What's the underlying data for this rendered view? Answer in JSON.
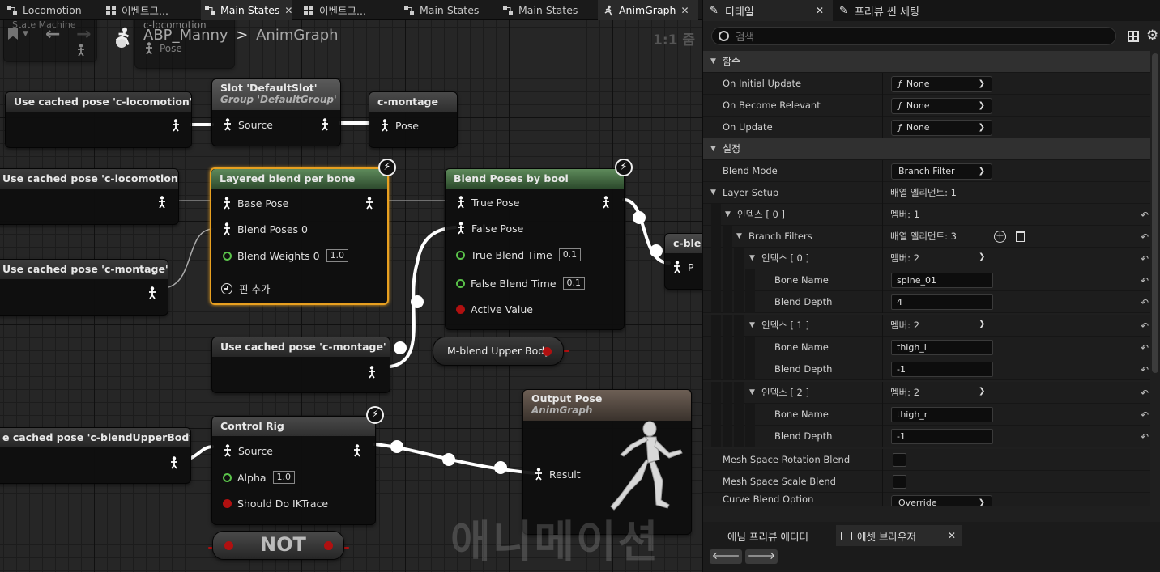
{
  "tabs": [
    {
      "label": "Locomotion",
      "icon": "state-machine-icon",
      "close": ""
    },
    {
      "label": "이벤트그...",
      "icon": "event-graph-icon",
      "close": ""
    },
    {
      "label": "Main States",
      "icon": "state-machine-icon",
      "close": "✕"
    },
    {
      "label": "이벤트그...",
      "icon": "event-graph-icon",
      "close": ""
    },
    {
      "label": "Main States",
      "icon": "state-machine-icon",
      "close": ""
    },
    {
      "label": "Main States",
      "icon": "state-machine-icon",
      "close": ""
    },
    {
      "label": "AnimGraph",
      "icon": "anim-graph-icon",
      "close": "✕"
    }
  ],
  "graph": {
    "breadcrumb_asset": "ABP_Manny",
    "breadcrumb_sep": ">",
    "breadcrumb_graph": "AnimGraph",
    "zoom": "1:1 줌",
    "watermark": "애니메이션",
    "top_node": {
      "title": "c-locomotion",
      "pin": "Pose",
      "faded": "State Machine"
    },
    "nodes": {
      "cached_loco_1": {
        "title": "Use cached pose 'c-locomotion'"
      },
      "slot": {
        "title": "Slot 'DefaultSlot'",
        "subtitle": "Group 'DefaultGroup'",
        "pin": "Source"
      },
      "c_montage": {
        "title": "c-montage",
        "pin": "Pose"
      },
      "cached_loco_2": {
        "title": "Use cached pose 'c-locomotion'"
      },
      "cached_montage_1": {
        "title": "Use cached pose 'c-montage'"
      },
      "layered": {
        "title": "Layered blend per bone",
        "pin_base": "Base Pose",
        "pin_blend": "Blend Poses 0",
        "pin_weights": "Blend Weights 0",
        "weights_val": "1.0",
        "add_pin": "핀 추가"
      },
      "blend_bool": {
        "title": "Blend Poses by bool",
        "pin_true": "True Pose",
        "pin_false": "False Pose",
        "pin_true_time": "True Blend Time",
        "true_time_val": "0.1",
        "pin_false_time": "False Blend Time",
        "false_time_val": "0.1",
        "pin_active": "Active Value"
      },
      "c_blend": {
        "title": "c-ble",
        "pin": "P"
      },
      "cached_montage_2": {
        "title": "Use cached pose 'c-montage'"
      },
      "m_blend": {
        "title": "M-blend Upper Body"
      },
      "output": {
        "title": "Output Pose",
        "subtitle": "AnimGraph",
        "pin": "Result"
      },
      "cached_blend_upper": {
        "title": "e cached pose 'c-blendUpperBody'"
      },
      "control_rig": {
        "title": "Control Rig",
        "pin_source": "Source",
        "pin_alpha": "Alpha",
        "alpha_val": "1.0",
        "pin_ik": "Should Do IKTrace"
      },
      "not_node": {
        "title": "NOT"
      }
    }
  },
  "details": {
    "tabs": [
      {
        "label": "디테일",
        "close": "✕"
      },
      {
        "label": "프리뷰 씬 세팅",
        "close": ""
      }
    ],
    "search_placeholder": "검색",
    "cat_functions": "함수",
    "on_initial_update": {
      "label": "On Initial Update",
      "value": "None"
    },
    "on_become_relevant": {
      "label": "On Become Relevant",
      "value": "None"
    },
    "on_update": {
      "label": "On Update",
      "value": "None"
    },
    "cat_settings": "설정",
    "blend_mode": {
      "label": "Blend Mode",
      "value": "Branch Filter"
    },
    "layer_setup": {
      "label": "Layer Setup",
      "value": "배열 엘리먼트: 1"
    },
    "index0": {
      "label": "인덱스 [ 0 ]",
      "value": "멤버: 1"
    },
    "branch_filters": {
      "label": "Branch Filters",
      "value": "배열 엘리먼트: 3"
    },
    "bf0": {
      "label": "인덱스 [ 0 ]",
      "value": "멤버: 2",
      "bone_label": "Bone Name",
      "bone": "spine_01",
      "depth_label": "Blend Depth",
      "depth": "4"
    },
    "bf1": {
      "label": "인덱스 [ 1 ]",
      "value": "멤버: 2",
      "bone_label": "Bone Name",
      "bone": "thigh_l",
      "depth_label": "Blend Depth",
      "depth": "-1"
    },
    "bf2": {
      "label": "인덱스 [ 2 ]",
      "value": "멤버: 2",
      "bone_label": "Bone Name",
      "bone": "thigh_r",
      "depth_label": "Blend Depth",
      "depth": "-1"
    },
    "mesh_rot": {
      "label": "Mesh Space Rotation Blend"
    },
    "mesh_scale": {
      "label": "Mesh Space Scale Blend"
    },
    "curve_blend": {
      "label": "Curve Blend Option",
      "value": "Override"
    },
    "bottom_tabs": [
      {
        "label": "애님 프리뷰 에디터"
      },
      {
        "label": "에셋 브라우저",
        "close": "✕"
      }
    ],
    "func_icon": "ƒ",
    "reset_icon": "↶",
    "nav_back": "🡐",
    "nav_forward": "🡒"
  },
  "colors": {
    "accent_orange": "#e8a020",
    "exec_green": "#5ac34a",
    "bool_red": "#b01010",
    "node_green": "#5e8a5b"
  }
}
